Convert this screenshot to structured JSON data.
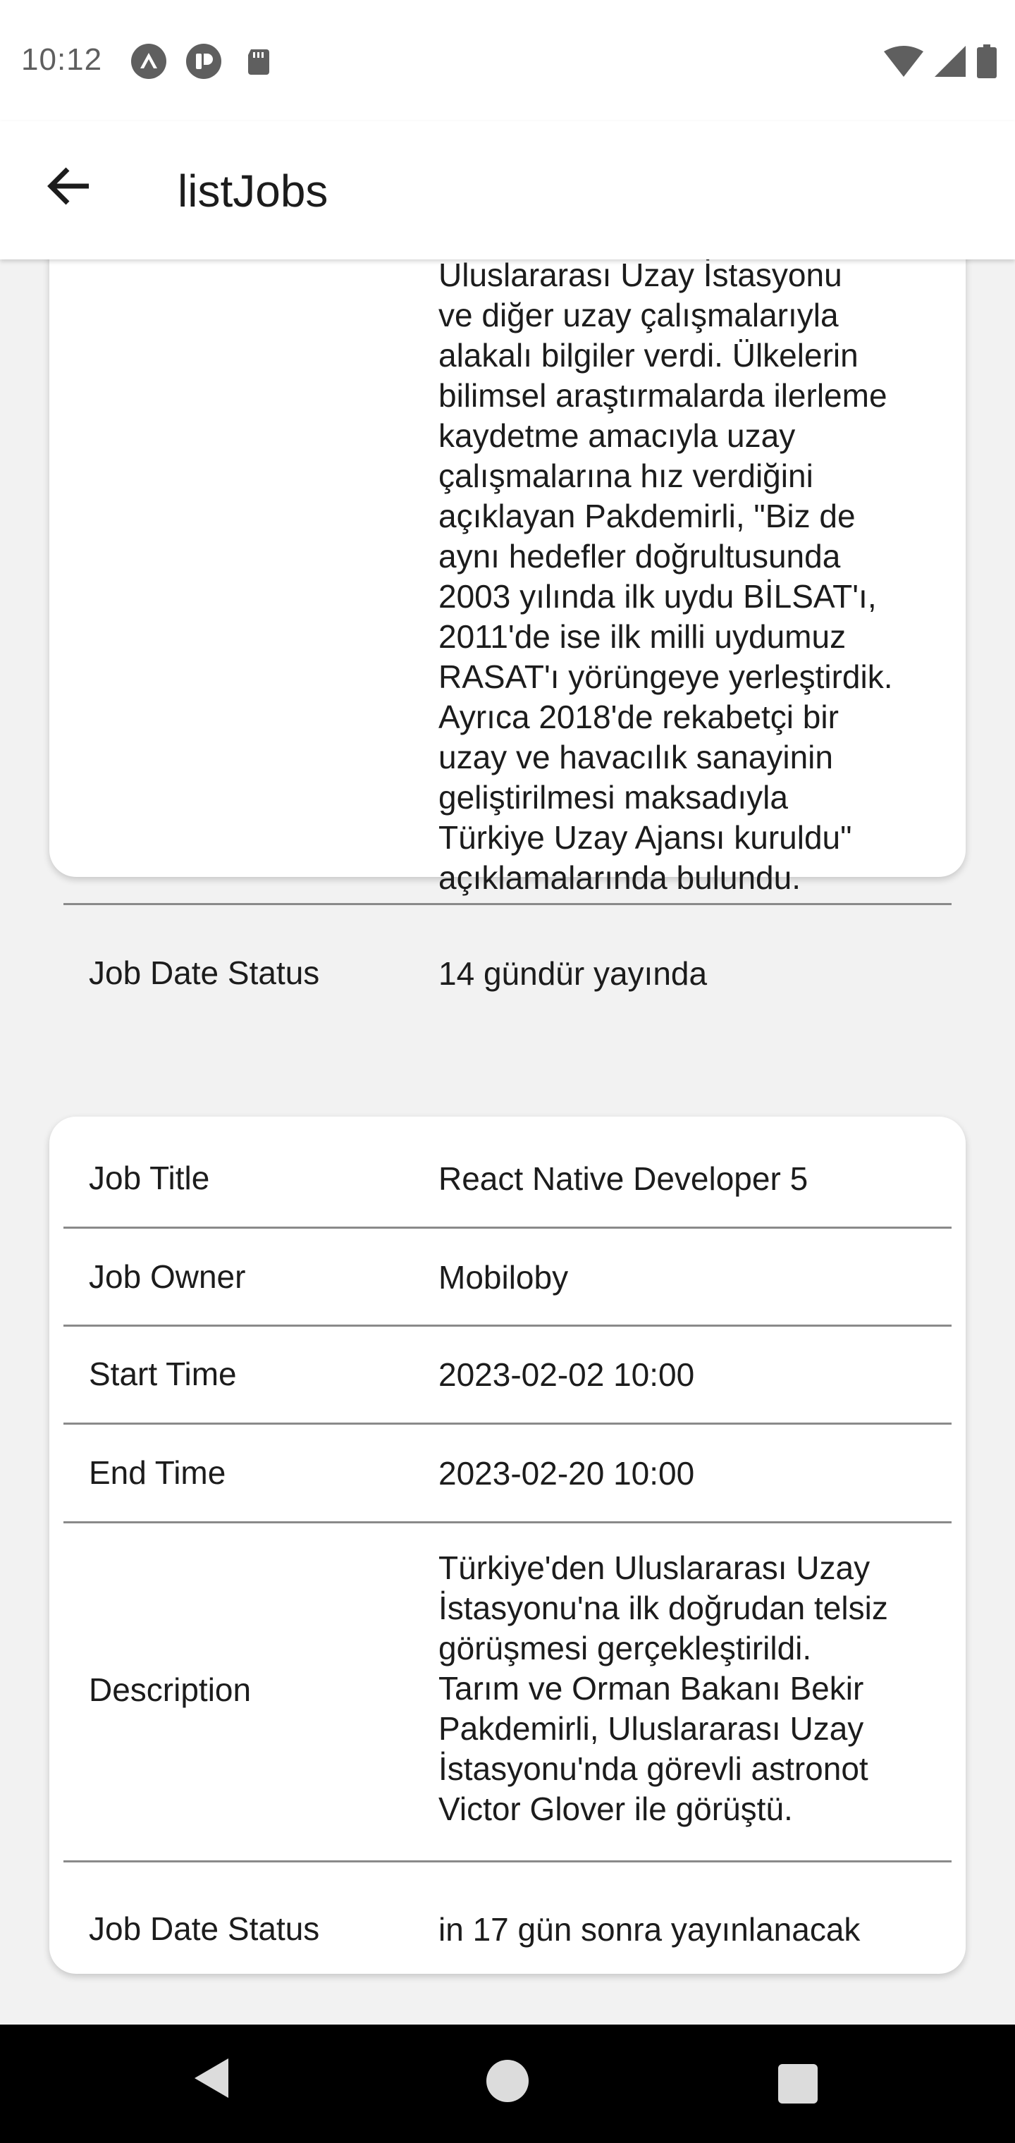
{
  "status_bar": {
    "time": "10:12"
  },
  "header": {
    "title": "listJobs"
  },
  "cards": [
    {
      "description_lines": [
        "Uluslararası Uzay İstasyonu",
        "ve diğer uzay çalışmalarıyla",
        "alakalı bilgiler verdi. Ülkelerin",
        "bilimsel araştırmalarda ilerleme",
        "kaydetme amacıyla uzay",
        "çalışmalarına hız verdiğini",
        "açıklayan Pakdemirli, \"Biz de",
        "aynı hedefler doğrultusunda",
        "2003 yılında ilk uydu BİLSAT'ı,",
        "2011'de ise ilk milli uydumuz",
        "RASAT'ı yörüngeye yerleştirdik.",
        "Ayrıca 2018'de rekabetçi bir",
        "uzay ve havacılık sanayinin",
        "geliştirilmesi maksadıyla",
        "Türkiye Uzay Ajansı kuruldu\"",
        "açıklamalarında bulundu."
      ],
      "job_date_status_label": "Job Date Status",
      "job_date_status": "14 gündür yayında"
    },
    {
      "job_title_label": "Job Title",
      "job_title": "React Native Developer 5",
      "job_owner_label": "Job Owner",
      "job_owner": "Mobiloby",
      "start_time_label": "Start Time",
      "start_time": "2023-02-02 10:00",
      "end_time_label": "End Time",
      "end_time": "2023-02-20 10:00",
      "description_label": "Description",
      "description_lines": [
        "Türkiye'den Uluslararası Uzay",
        "İstasyonu'na ilk doğrudan telsiz",
        "görüşmesi gerçekleştirildi.",
        "Tarım ve Orman Bakanı Bekir",
        "Pakdemirli, Uluslararası Uzay",
        "İstasyonu'nda görevli astronot",
        "Victor Glover ile görüştü."
      ],
      "job_date_status_label": "Job Date Status",
      "job_date_status": "in 17 gün sonra yayınlanacak"
    }
  ],
  "icons": {
    "status": [
      "expo-icon",
      "notification-app-icon",
      "sd-card-icon"
    ],
    "system": [
      "wifi-icon",
      "signal-icon",
      "battery-icon"
    ],
    "header": "back-arrow-icon",
    "nav": [
      "nav-back-icon",
      "nav-home-icon",
      "nav-recents-icon"
    ]
  }
}
